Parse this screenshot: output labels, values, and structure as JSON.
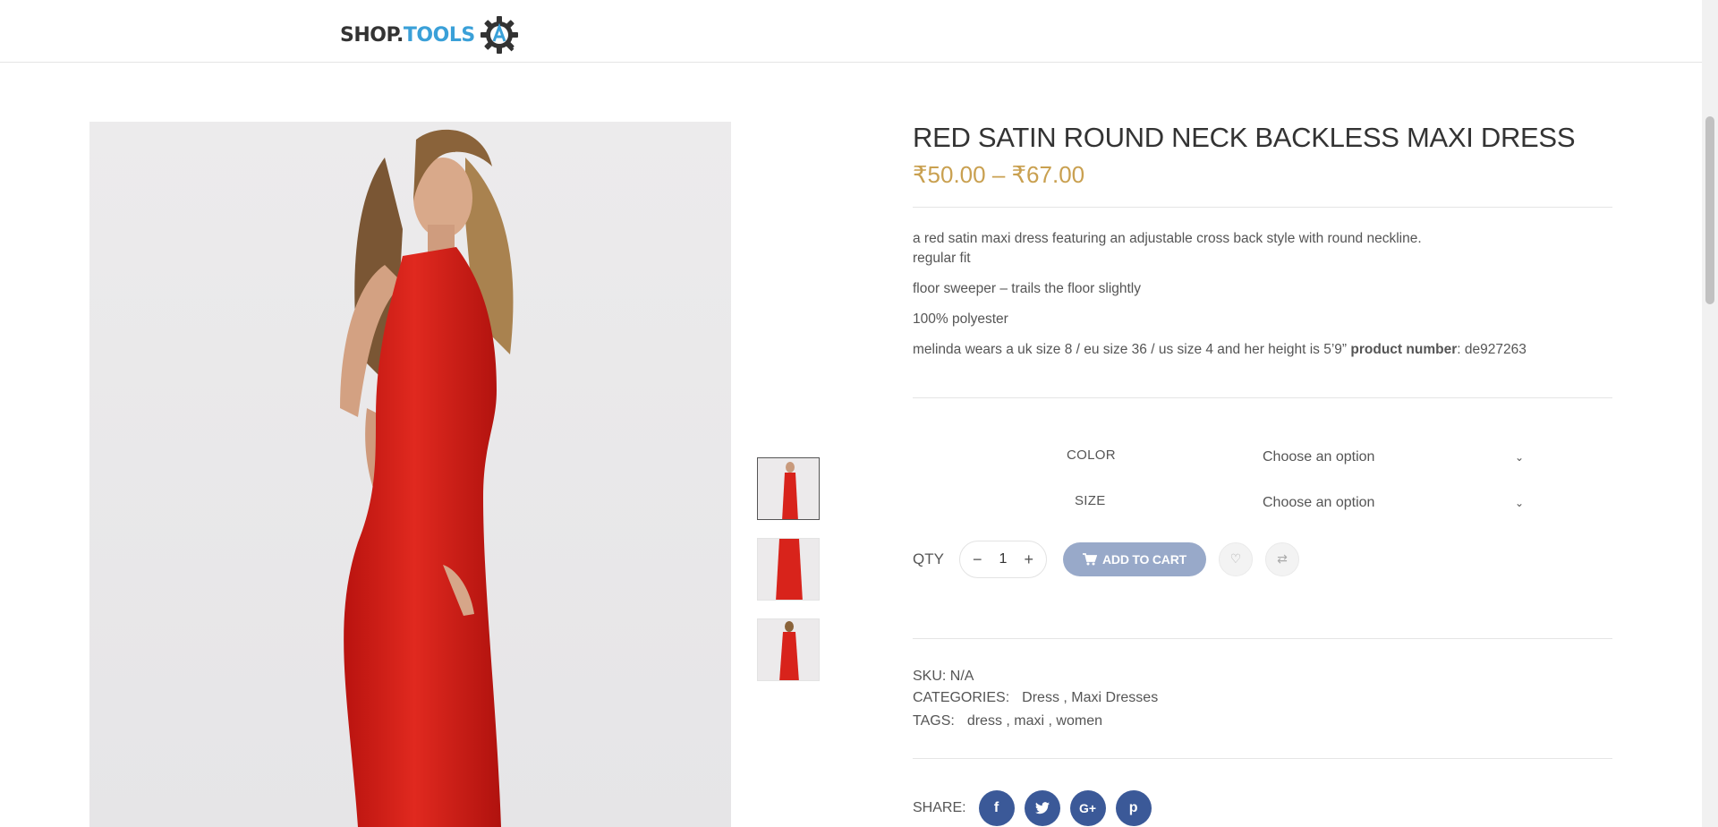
{
  "header": {
    "logo_text_part1": "SHOP.",
    "logo_text_part2": "TOOLS"
  },
  "product": {
    "title": "RED SATIN ROUND NECK BACKLESS MAXI DRESS",
    "price": "₹50.00 – ₹67.00",
    "description": [
      "a red satin maxi dress featuring an adjustable cross back style with round neckline.",
      "regular fit",
      "floor sweeper – trails the floor slightly",
      "100% polyester",
      "melinda wears a uk size 8 / eu size 36 / us size 4 and her height is 5’9”"
    ],
    "product_number_label": "product number",
    "product_number_value": ": de927263"
  },
  "variations": {
    "color_label": "COLOR",
    "color_value": "Choose an option",
    "size_label": "SIZE",
    "size_value": "Choose an option"
  },
  "cart": {
    "qty_label": "QTY",
    "qty_value": "1",
    "minus": "−",
    "plus": "+",
    "add_to_cart_label": "ADD TO CART"
  },
  "meta": {
    "sku_label": "SKU:",
    "sku_value": "N/A",
    "categories_label": "CATEGORIES:",
    "categories_value": "Dress , Maxi Dresses",
    "tags_label": "TAGS:",
    "tags_value": "dress , maxi , women"
  },
  "share": {
    "label": "SHARE:",
    "facebook": "f",
    "twitter": "t",
    "googleplus": "G+",
    "pinterest": "p"
  },
  "colors": {
    "price": "#c9a050",
    "add_to_cart_bg": "#98a9c9",
    "social_bg": "#3b5998",
    "dress": "#d8231b"
  }
}
